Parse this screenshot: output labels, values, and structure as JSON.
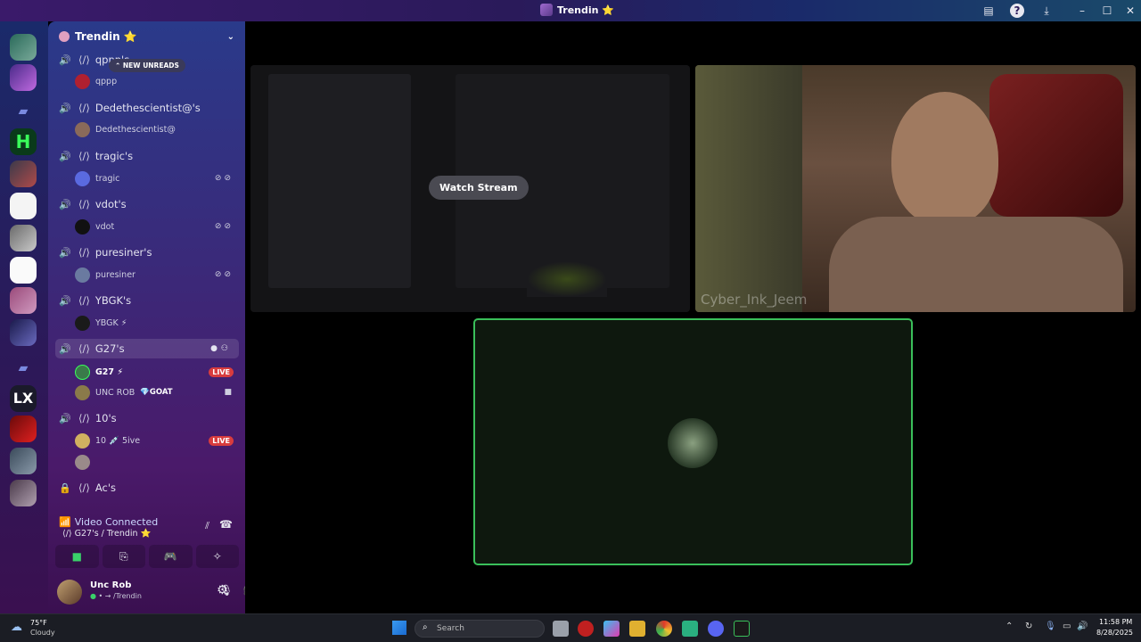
{
  "window": {
    "title": "Trendin ⭐"
  },
  "server": {
    "name": "Trendin ⭐",
    "unread_pill": "NEW UNREADS"
  },
  "channels": [
    {
      "name": "qppp's",
      "users": [
        {
          "name": "qppp",
          "badge": ""
        }
      ]
    },
    {
      "name": "Dedethescientist@'s",
      "users": [
        {
          "name": "Dedethescientist@",
          "badge": ""
        }
      ]
    },
    {
      "name": "tragic's",
      "users": [
        {
          "name": "tragic",
          "badge": ""
        }
      ]
    },
    {
      "name": "vdot's",
      "users": [
        {
          "name": "vdot",
          "badge": ""
        }
      ]
    },
    {
      "name": "puresiner's",
      "users": [
        {
          "name": "puresiner",
          "badge": ""
        }
      ]
    },
    {
      "name": "YBGK's",
      "users": [
        {
          "name": "YBGK ⚡",
          "badge": ""
        }
      ]
    },
    {
      "name": "G27's",
      "users": [
        {
          "name": "G27 ⚡",
          "badge": "LIVE"
        },
        {
          "name": "UNC ROB",
          "badge": "GOAT"
        }
      ]
    },
    {
      "name": "10's",
      "users": [
        {
          "name": "10 💉 5ive",
          "badge": "LIVE"
        }
      ]
    },
    {
      "name": "Ac's",
      "users": []
    }
  ],
  "voice": {
    "status": "Video Connected",
    "location": "G27's / Trendin ⭐"
  },
  "user": {
    "name": "Unc Rob",
    "status": "/Trendin"
  },
  "stage": {
    "watch_label": "Watch Stream",
    "watermark": "Cyber_Ink_Jeem"
  },
  "taskbar": {
    "weather_temp": "75°F",
    "weather_desc": "Cloudy",
    "search_placeholder": "Search",
    "time": "11:58 PM",
    "date": "8/28/2025"
  }
}
